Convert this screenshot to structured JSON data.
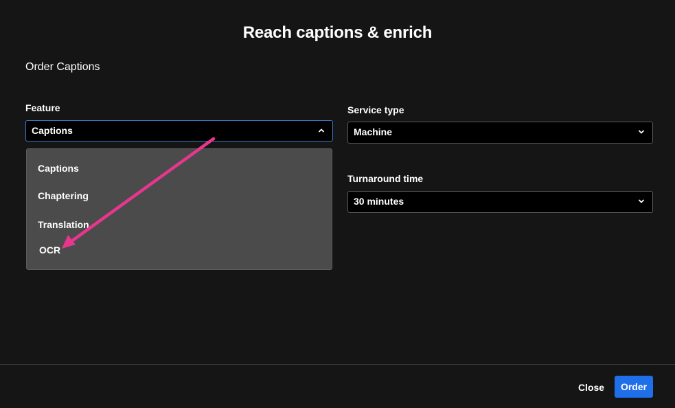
{
  "dialog": {
    "title": "Reach captions & enrich",
    "subtitle": "Order Captions"
  },
  "feature": {
    "label": "Feature",
    "selected": "Captions",
    "expanded": true,
    "options": [
      "Captions",
      "Chaptering",
      "Translation",
      "OCR"
    ]
  },
  "service_type": {
    "label": "Service type",
    "selected": "Machine"
  },
  "turnaround": {
    "label": "Turnaround time",
    "selected": "30 minutes"
  },
  "annotation": {
    "arrow_color": "#e8368f",
    "points_to": "OCR"
  },
  "footer": {
    "close_label": "Close",
    "order_label": "Order"
  },
  "colors": {
    "background": "#151515",
    "accent": "#1e6fe8",
    "dropdown_bg": "#4b4b4b",
    "focus_border": "#3a78c8"
  }
}
